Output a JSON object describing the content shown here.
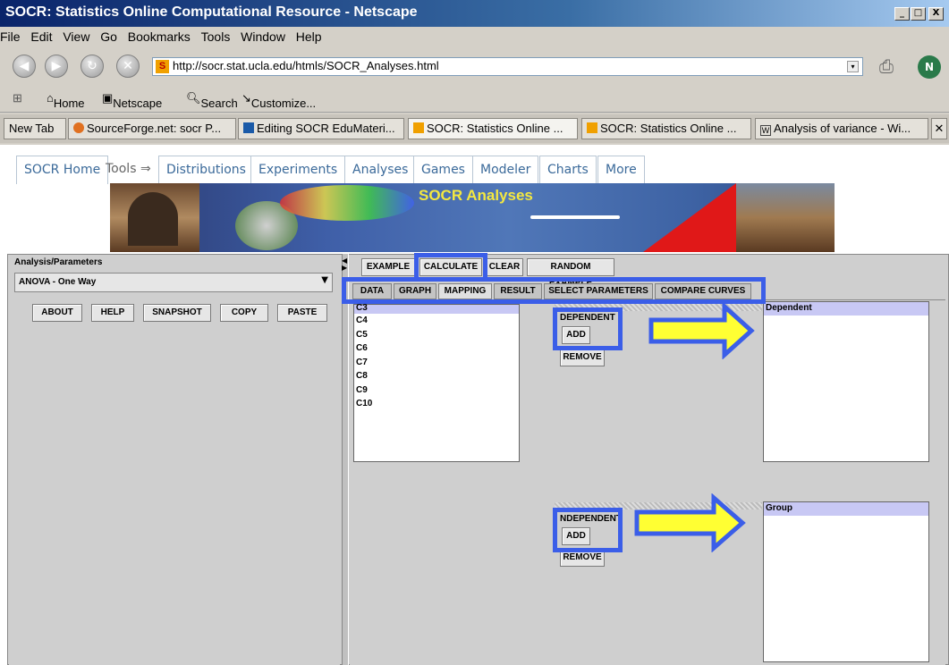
{
  "window": {
    "title": "SOCR: Statistics Online Computational Resource - Netscape",
    "controls": [
      "_",
      "□",
      "X"
    ]
  },
  "menu": [
    "File",
    "Edit",
    "View",
    "Go",
    "Bookmarks",
    "Tools",
    "Window",
    "Help"
  ],
  "nav": {
    "url": "http://socr.stat.ucla.edu/htmls/SOCR_Analyses.html"
  },
  "personal_toolbar": {
    "home": "Home",
    "netscape": "Netscape",
    "search": "Search",
    "customize": "Customize..."
  },
  "browser_tabs": [
    "New Tab",
    "SourceForge.net: socr P...",
    "Editing SOCR EduMateri...",
    "SOCR: Statistics Online ...",
    "SOCR: Statistics Online ...",
    "Analysis of variance - Wi..."
  ],
  "site_nav": {
    "home": "SOCR Home",
    "tools_label": "Tools ⇒",
    "items": [
      "Distributions",
      "Experiments",
      "Analyses",
      "Games",
      "Modeler",
      "Charts",
      "More"
    ]
  },
  "banner": {
    "title": "SOCR Analyses"
  },
  "left_panel": {
    "section_label": "Analysis/Parameters",
    "analysis_selected": "ANOVA - One Way",
    "buttons": [
      "ABOUT",
      "HELP",
      "SNAPSHOT",
      "COPY",
      "PASTE"
    ]
  },
  "toolbar_buttons": [
    "EXAMPLE",
    "CALCULATE",
    "CLEAR",
    "RANDOM EXAMPLE"
  ],
  "tabs": [
    "DATA",
    "GRAPH",
    "MAPPING",
    "RESULT",
    "SELECT PARAMETERS",
    "COMPARE CURVES"
  ],
  "selected_tab": "MAPPING",
  "variables": [
    "C3",
    "C4",
    "C5",
    "C6",
    "C7",
    "C8",
    "C9",
    "C10"
  ],
  "dependent": {
    "label": "DEPENDENT",
    "add": "ADD",
    "remove": "REMOVE",
    "list_header": "Dependent"
  },
  "independent": {
    "label": "NDEPENDENT",
    "add": "ADD",
    "remove": "REMOVE",
    "list_header": "Group"
  },
  "colors": {
    "highlight_border": "#3b5ee8",
    "arrow_fill": "#ffff33",
    "list_header": "#c8c8f4"
  }
}
